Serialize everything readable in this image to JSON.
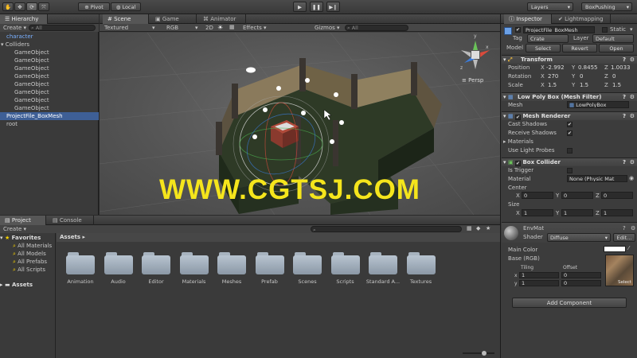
{
  "toolbar": {
    "pivot": "Pivot",
    "local": "Local",
    "layers": "Layers",
    "layout": "BoxPushing"
  },
  "hierarchy": {
    "tab": "Hierarchy",
    "create": "Create",
    "search_placeholder": "All",
    "items": [
      {
        "label": "character",
        "indent": 0
      },
      {
        "label": "Colliders",
        "indent": 0
      },
      {
        "label": "GameObject",
        "indent": 1
      },
      {
        "label": "GameObject",
        "indent": 1
      },
      {
        "label": "GameObject",
        "indent": 1
      },
      {
        "label": "GameObject",
        "indent": 1
      },
      {
        "label": "GameObject",
        "indent": 1
      },
      {
        "label": "GameObject",
        "indent": 1
      },
      {
        "label": "GameObject",
        "indent": 1
      },
      {
        "label": "GameObject",
        "indent": 1
      },
      {
        "label": "ProjectFile_BoxMesh",
        "indent": 0
      },
      {
        "label": "root",
        "indent": 0
      }
    ]
  },
  "scene": {
    "tabs": [
      "Scene",
      "Game",
      "Animator"
    ],
    "textured": "Textured",
    "rgb": "RGB",
    "mode2d": "2D",
    "effects": "Effects",
    "gizmos": "Gizmos",
    "search_placeholder": "All",
    "persp": "Persp",
    "watermark": "WWW.CGTSJ.COM",
    "gizmo_axes": [
      "y",
      "x",
      "z"
    ]
  },
  "project": {
    "tabs": [
      "Project",
      "Console"
    ],
    "create": "Create",
    "favorites_title": "Favorites",
    "favorites": [
      "All Materials",
      "All Models",
      "All Prefabs",
      "All Scripts"
    ],
    "assets_root": "Assets",
    "breadcrumb": "Assets",
    "folders": [
      "Animation",
      "Audio",
      "Editor",
      "Materials",
      "Meshes",
      "Prefab",
      "Scenes",
      "Scripts",
      "Standard A...",
      "Textures"
    ]
  },
  "inspector": {
    "tabs": [
      "Inspector",
      "Lightmapping"
    ],
    "object_name": "ProjectFile_BoxMesh",
    "static": "Static",
    "tag_label": "Tag",
    "tag_value": "Crate",
    "layer_label": "Layer",
    "layer_value": "Default",
    "model_label": "Model",
    "model_buttons": [
      "Select",
      "Revert",
      "Open"
    ],
    "transform": {
      "title": "Transform",
      "position_label": "Position",
      "position": {
        "x": "-2.992",
        "y": "0.8455",
        "z": "1.0033"
      },
      "rotation_label": "Rotation",
      "rotation": {
        "x": "270",
        "y": "0",
        "z": "0"
      },
      "scale_label": "Scale",
      "scale": {
        "x": "1.5",
        "y": "1.5",
        "z": "1.5"
      }
    },
    "mesh_filter": {
      "title": "Low Poly Box (Mesh Filter)",
      "mesh_label": "Mesh",
      "mesh_value": "LowPolyBox"
    },
    "mesh_renderer": {
      "title": "Mesh Renderer",
      "cast_shadows": "Cast Shadows",
      "receive_shadows": "Receive Shadows",
      "materials": "Materials",
      "use_light_probes": "Use Light Probes"
    },
    "box_collider": {
      "title": "Box Collider",
      "is_trigger": "Is Trigger",
      "material_label": "Material",
      "material_value": "None (Physic Mat",
      "center_label": "Center",
      "center": {
        "x": "0",
        "y": "0",
        "z": "0"
      },
      "size_label": "Size",
      "size": {
        "x": "1",
        "y": "1",
        "z": "1"
      }
    },
    "material": {
      "name": "EnvMat",
      "shader_label": "Shader",
      "shader_value": "Diffuse",
      "edit": "Edit...",
      "main_color": "Main Color",
      "base": "Base (RGB)",
      "tiling": "Tiling",
      "offset": "Offset",
      "tiling_x": "1",
      "tiling_y": "1",
      "offset_x": "0",
      "offset_y": "0",
      "select": "Select"
    },
    "add_component": "Add Component"
  }
}
